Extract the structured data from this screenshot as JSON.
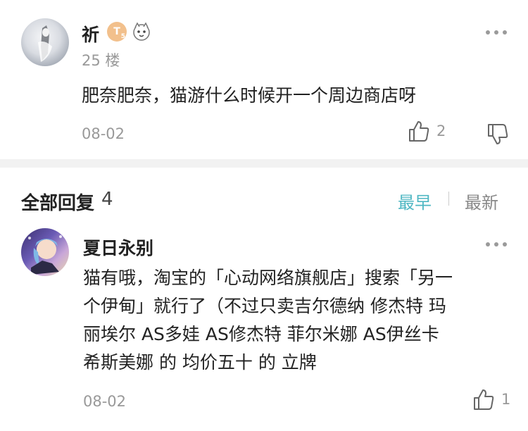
{
  "post": {
    "username": "祈",
    "badge_text": "T",
    "badge_level": "5",
    "floor": "25 楼",
    "content": "肥奈肥奈，猫游什么时候开一个周边商店呀",
    "date": "08-02",
    "like_count": "2"
  },
  "replies_header": {
    "title": "全部回复",
    "count": "4",
    "sort_earliest": "最早",
    "sort_latest": "最新",
    "active_color": "#4fb7c3"
  },
  "reply": {
    "username": "夏日永别",
    "content_lines": [
      "猫有哦，淘宝的「心动网络旗舰店」搜索「另一",
      "个伊甸」就行了（不过只卖吉尔德纳 修杰特 玛",
      "丽埃尔 AS多娃 AS修杰特 菲尔米娜 AS伊丝卡",
      "希斯美娜 的 均价五十 的 立牌"
    ],
    "date": "08-02",
    "like_count": "1"
  }
}
